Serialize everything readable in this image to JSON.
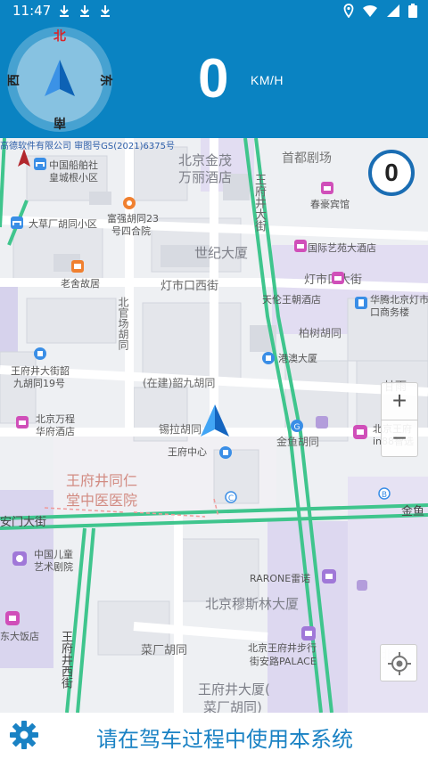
{
  "status_bar": {
    "time": "11:47",
    "icons": [
      "download-icon",
      "download-icon",
      "download-icon",
      "location-icon",
      "wifi-icon",
      "signal-icon",
      "battery-icon"
    ]
  },
  "compass": {
    "north": "北",
    "south": "南",
    "west": "西",
    "east": "东"
  },
  "speed": {
    "value": "0",
    "unit": "KM/H"
  },
  "map": {
    "credit": "高德软件有限公司 审图号GS(2021)6375号",
    "speed_limit": "0",
    "labels": {
      "beijing_jinmao": "北京金茂",
      "wanli_hotel": "万丽酒店",
      "shoudu_theatre": "首都剧场",
      "cbrc_residence": "中国船舶社",
      "huangcheng_area": "皇城根小区",
      "dacaochang": "大草厂胡同小区",
      "fuqiang": "富强胡同23",
      "fuqiang2": "号四合院",
      "chunhao": "春豪宾馆",
      "wangfujing_st": "王府井大街",
      "shiji_building": "世纪大厦",
      "guoji_hotel": "国际艺苑大酒店",
      "laoshe": "老舍故居",
      "dengshi_w": "灯市口西街",
      "dengshi_e": "灯市口大街",
      "tianlun": "天伦王朝酒店",
      "huateng": "华腾北京灯市",
      "huateng2": "口商务楼",
      "beiguan": "北官场胡同",
      "baishu": "柏树胡同",
      "gangmei": "港澳大厦",
      "wfj_shao": "王府井大街韶",
      "wfj_shao2": "九胡同19号",
      "zaijian": "(在建)韶九胡同",
      "ganyu": "甘雨",
      "wanfu": "北京万程",
      "wanfu2": "华府酒店",
      "xila": "锡拉胡同",
      "wfj_center": "王府中心",
      "wfj_hotel": "北京王府",
      "wfj_hotel2": "in88智选",
      "jinyu": "金鱼胡同",
      "tongren": "王府井同仁",
      "tongren2": "堂中医医院",
      "andi": "安门大街",
      "jinyu_short": "金鱼",
      "ertong": "中国儿童",
      "ertong2": "艺术剧院",
      "rarone": "RARONE雷诺",
      "muslim": "北京穆斯林大厦",
      "dafandian": "东大饭店",
      "caichang": "菜厂胡同",
      "bux_st": "北京王府井步行",
      "palace": "街安路PALACE",
      "wfj_west": "王府井西街",
      "wfj_building": "王府井大厦(",
      "caichang2": "菜厂胡同)",
      "beijing_right": "北京"
    },
    "zoom_in": "+",
    "zoom_out": "−"
  },
  "bottom": {
    "notice": "请在驾车过程中使用本系统"
  },
  "colors": {
    "header_bg": "#0a83c2",
    "accent": "#1a82c4",
    "road_green": "#3fc58d"
  }
}
